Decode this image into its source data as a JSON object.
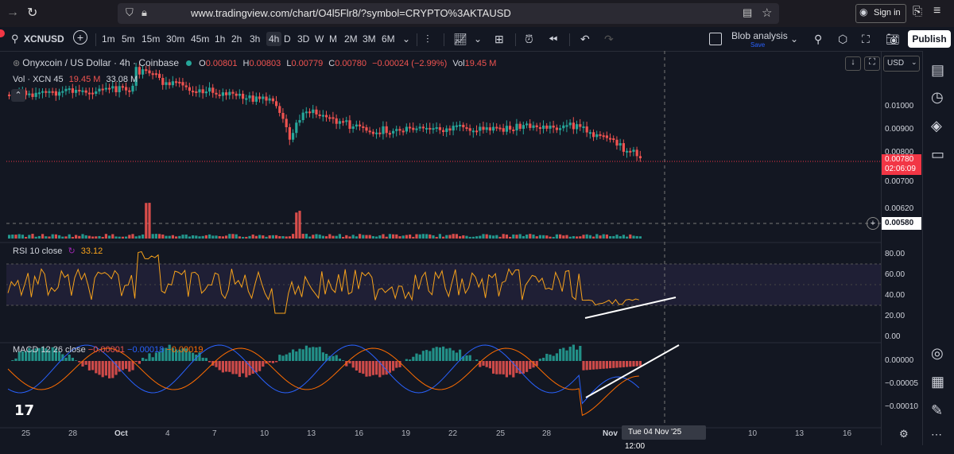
{
  "browser": {
    "url": "www.tradingview.com/chart/O4l5Flr8/?symbol=CRYPTO%3AKTAUSD",
    "sign_in": "Sign in"
  },
  "toolbar": {
    "symbol": "XCNUSD",
    "intervals": [
      "1m",
      "5m",
      "15m",
      "30m",
      "45m",
      "1h",
      "2h",
      "3h",
      "4h",
      "D",
      "3D",
      "W",
      "M",
      "2M",
      "3M",
      "6M"
    ],
    "active_interval": "4h",
    "layout_name": "Blob analysis",
    "layout_sub": "Save",
    "publish": "Publish"
  },
  "legend": {
    "title": "Onyxcoin / US Dollar · 4h · Coinbase",
    "o_label": "O",
    "o": "0.00801",
    "h_label": "H",
    "h": "0.00803",
    "l_label": "L",
    "l": "0.00779",
    "c_label": "C",
    "c": "0.00780",
    "change": "−0.00024 (−2.99%)",
    "vol_label": "Vol",
    "vol": "19.45 M",
    "vol_row_label": "Vol · XCN 45",
    "vol_row_v1": "19.45 M",
    "vol_row_v2": "33.08 M",
    "rsi_label": "RSI 10 close",
    "rsi_value": "33.12",
    "macd_label": "MACD 12 26 close",
    "macd_v1": "−0.00001",
    "macd_v2": "−0.00018",
    "macd_v3": "−0.00019"
  },
  "price_axis": {
    "currency": "USD",
    "labels": [
      "0.01000",
      "0.00900",
      "0.00800",
      "0.00700",
      "0.00620",
      "0.00580"
    ],
    "current_price": "0.00780",
    "countdown": "02:06:09",
    "crosshair_price": "0.00580",
    "rsi_labels": [
      "80.00",
      "60.00",
      "40.00",
      "20.00",
      "0.00"
    ],
    "macd_labels": [
      "0.00000",
      "−0.00005",
      "−0.00010"
    ]
  },
  "time_axis": {
    "labels": [
      "25",
      "28",
      "Oct",
      "4",
      "7",
      "10",
      "13",
      "16",
      "19",
      "22",
      "25",
      "28",
      "Nov",
      "10",
      "13",
      "16"
    ],
    "crosshair_time": "Tue 04 Nov '25",
    "crosshair_hour": "12:00"
  },
  "colors": {
    "up": "#26a69a",
    "down": "#ef5350",
    "rsi": "#f7a21b",
    "macd": "#2962ff",
    "signal": "#ff6d00",
    "accent": "#2962ff"
  }
}
